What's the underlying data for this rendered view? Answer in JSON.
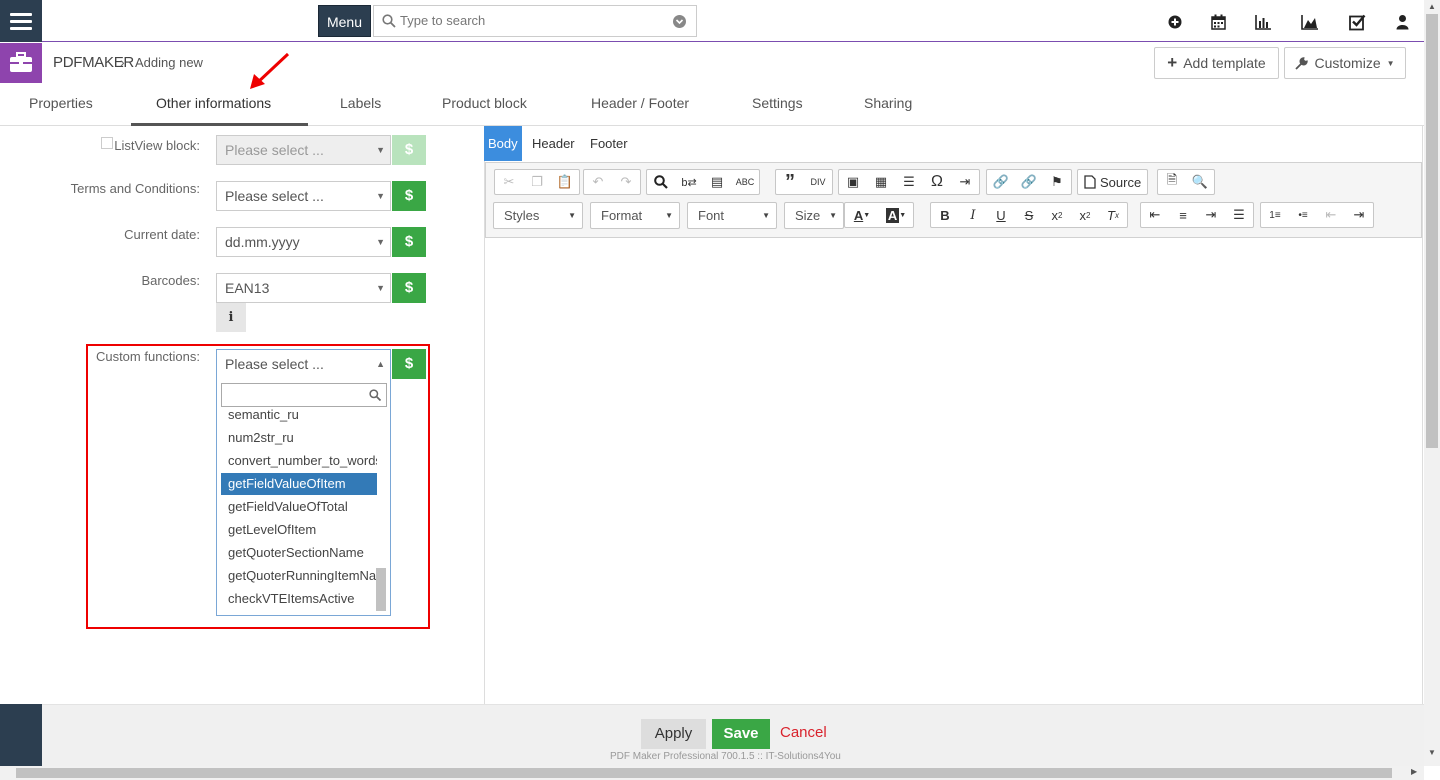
{
  "topbar": {
    "menu_label": "Menu",
    "search_placeholder": "Type to search",
    "icons": [
      "plus-circle-icon",
      "calendar-icon",
      "bar-chart-icon",
      "area-chart-icon",
      "checkbox-icon",
      "user-icon"
    ]
  },
  "breadcrumb": {
    "module": "PDFMAKER",
    "current": "Adding new"
  },
  "header_buttons": {
    "add_template": "Add template",
    "customize": "Customize"
  },
  "tabs": [
    "Properties",
    "Other informations",
    "Labels",
    "Product block",
    "Header / Footer",
    "Settings",
    "Sharing"
  ],
  "active_tab": "Other informations",
  "fields": {
    "listview": {
      "label": "ListView block:",
      "value": "Please select ..."
    },
    "terms": {
      "label": "Terms and Conditions:",
      "value": "Please select ..."
    },
    "date": {
      "label": "Current date:",
      "value": "dd.mm.yyyy"
    },
    "barcodes": {
      "label": "Barcodes:",
      "value": "EAN13"
    },
    "custom": {
      "label": "Custom functions:",
      "value": "Please select ..."
    }
  },
  "dollar_label": "$",
  "info_label": "i",
  "custom_functions_options": [
    "semantic_ru",
    "num2str_ru",
    "convert_number_to_words",
    "getFieldValueOfItem",
    "getFieldValueOfTotal",
    "getLevelOfItem",
    "getQuoterSectionName",
    "getQuoterRunningItemName",
    "checkVTEItemsActive"
  ],
  "highlighted_option": "getFieldValueOfItem",
  "editor": {
    "tabs": [
      "Body",
      "Header",
      "Footer"
    ],
    "active_tab": "Body",
    "combos": [
      "Styles",
      "Format",
      "Font",
      "Size"
    ],
    "source_label": "Source"
  },
  "footer": {
    "apply": "Apply",
    "save": "Save",
    "cancel": "Cancel",
    "copyright": "PDF Maker Professional 700.1.5 :: IT-Solutions4You"
  },
  "colors": {
    "sidebar": "#2c3e50",
    "accent_purple": "#8e44ad",
    "success_green": "#3aa745",
    "highlight_blue": "#337ab7",
    "cancel_red": "#d9232d",
    "annotation_red": "#e00000"
  }
}
